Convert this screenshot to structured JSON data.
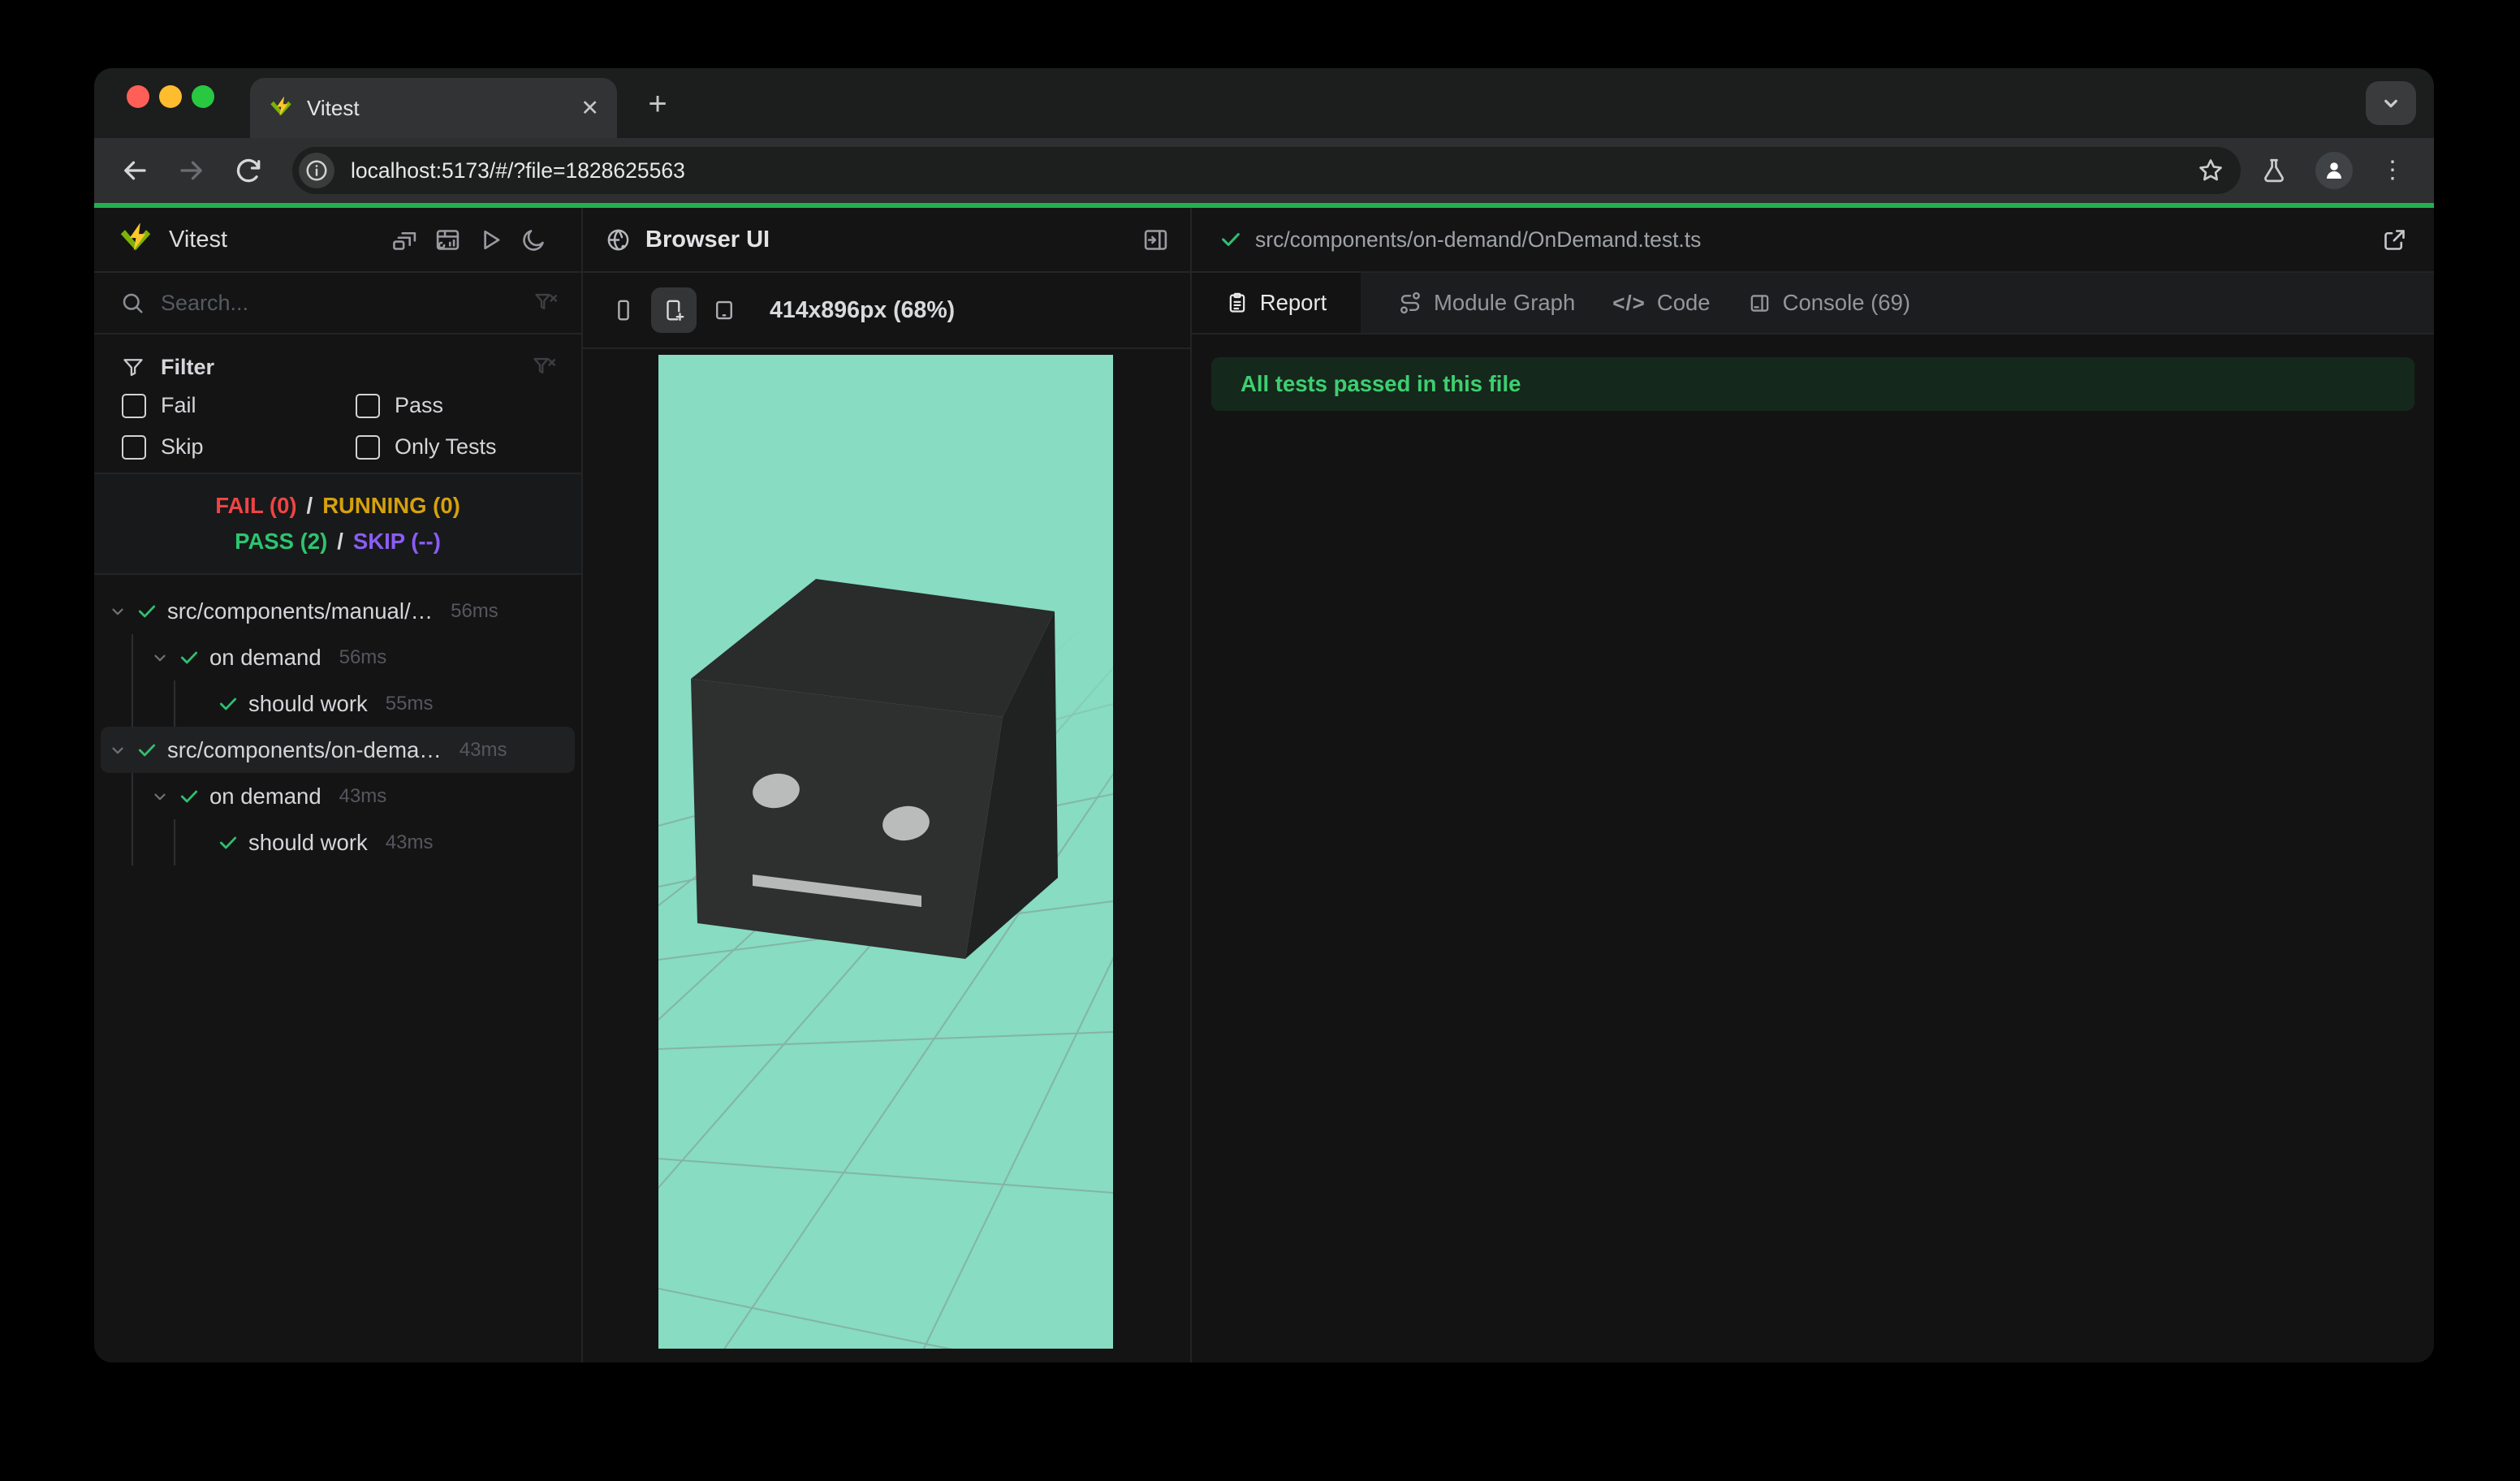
{
  "browser": {
    "tab_title": "Vitest",
    "url": "localhost:5173/#/?file=1828625563"
  },
  "icons": {
    "close": "✕",
    "plus": "+",
    "dots_vertical": "⋮",
    "code": "</>"
  },
  "sidebar": {
    "title": "Vitest",
    "search_placeholder": "Search...",
    "filter": {
      "title": "Filter",
      "options": [
        {
          "label": "Fail",
          "checked": false
        },
        {
          "label": "Pass",
          "checked": false
        },
        {
          "label": "Skip",
          "checked": false
        },
        {
          "label": "Only Tests",
          "checked": false
        }
      ]
    },
    "status": {
      "fail": "FAIL (0)",
      "running": "RUNNING (0)",
      "pass": "PASS (2)",
      "skip": "SKIP (--)",
      "sep": "/"
    },
    "tree": [
      {
        "label": "src/components/manual/…",
        "duration": "56ms",
        "level": 0,
        "state": "pass",
        "expanded": true
      },
      {
        "label": "on demand",
        "duration": "56ms",
        "level": 1,
        "state": "pass",
        "expanded": true
      },
      {
        "label": "should work",
        "duration": "55ms",
        "level": 2,
        "state": "pass"
      },
      {
        "label": "src/components/on-dema…",
        "duration": "43ms",
        "level": 0,
        "state": "pass",
        "expanded": true,
        "selected": true
      },
      {
        "label": "on demand",
        "duration": "43ms",
        "level": 1,
        "state": "pass",
        "expanded": true
      },
      {
        "label": "should work",
        "duration": "43ms",
        "level": 2,
        "state": "pass"
      }
    ]
  },
  "browser_panel": {
    "title": "Browser UI",
    "viewport_size": "414x896px (68%)"
  },
  "results": {
    "file_path": "src/components/on-demand/OnDemand.test.ts",
    "tabs": [
      {
        "label": "Report",
        "active": true
      },
      {
        "label": "Module Graph",
        "active": false
      },
      {
        "label": "Code",
        "active": false
      },
      {
        "label": "Console (69)",
        "active": false
      }
    ],
    "banner": "All tests passed in this file"
  },
  "colors": {
    "progress_green": "#21b14e",
    "pass_green": "#2fbf71",
    "fail_red": "#ef4444",
    "running_yellow": "#d6a10d",
    "skip_purple": "#8b5cf6",
    "viewport_bg": "#87dcc2"
  }
}
